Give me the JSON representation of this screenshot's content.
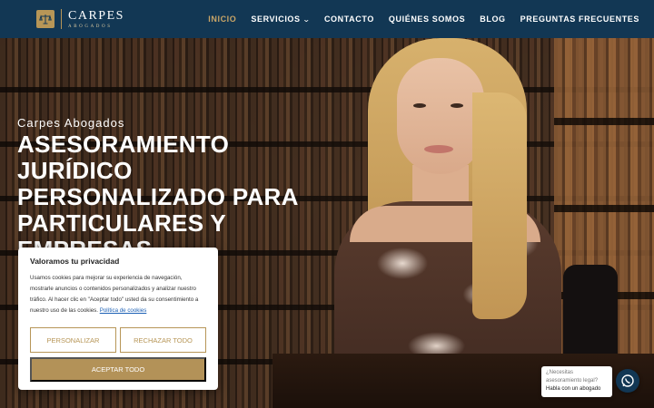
{
  "colors": {
    "header_bg": "#123754",
    "accent_gold": "#b79657",
    "nav_active": "#c9a567",
    "white": "#ffffff"
  },
  "logo": {
    "name": "CARPES",
    "subtitle": "ABOGADOS",
    "icon": "scales-of-justice-icon"
  },
  "nav": {
    "items": [
      {
        "label": "INICIO",
        "active": true
      },
      {
        "label": "SERVICIOS",
        "has_dropdown": true,
        "icon": "chevron-down-icon"
      },
      {
        "label": "CONTACTO"
      },
      {
        "label": "QUIÉNES SOMOS"
      },
      {
        "label": "BLOG"
      },
      {
        "label": "PREGUNTAS FRECUENTES"
      }
    ]
  },
  "hero": {
    "subtitle": "Carpes Abogados",
    "title": "ASESORAMIENTO JURÍDICO PERSONALIZADO PARA PARTICULARES Y EMPRESAS"
  },
  "cookie": {
    "title": "Valoramos tu privacidad",
    "text": "Usamos cookies para mejorar su experiencia de navegación, mostrarle anuncios o contenidos personalizados y analizar nuestro tráfico. Al hacer clic en \"Aceptar todo\" usted da su consentimiento a nuestro uso de las cookies.",
    "link": "Política de cookies",
    "customize": "PERSONALIZAR",
    "reject": "RECHAZAR TODO",
    "accept": "ACEPTAR TODO"
  },
  "whatsapp": {
    "question": "¿Necesitas asesoramiento legal?",
    "answer": "Habla con un abogado",
    "icon": "whatsapp-icon"
  }
}
